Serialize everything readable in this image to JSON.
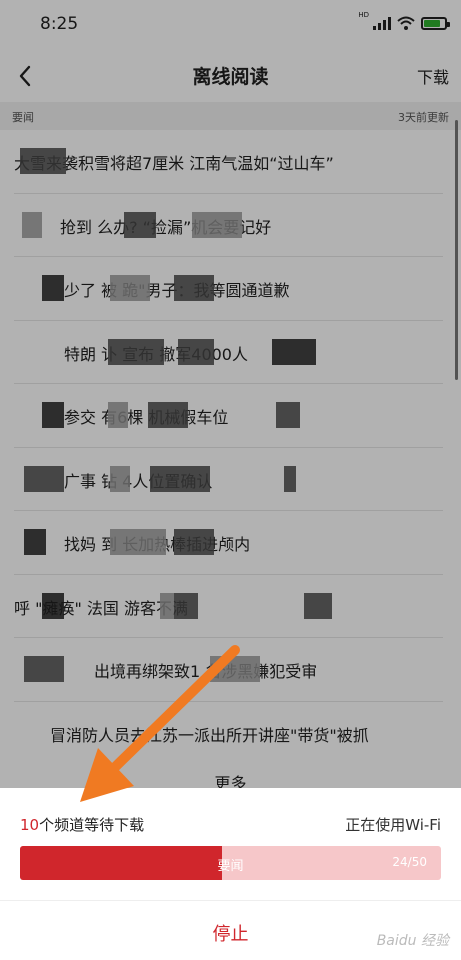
{
  "status_bar": {
    "time": "8:25",
    "network_badge": "HD"
  },
  "nav": {
    "title": "离线阅读",
    "action": "下载"
  },
  "section": {
    "label": "要闻",
    "updated": "3天前更新"
  },
  "news": [
    "大雪来袭积雪将超7厘米 江南气温如“过山车”",
    "抢到        么办?          “捡漏”机会要记好",
    "少了           被        跪\"男子：我等圆通道歉",
    "特朗          讣          宣布         撤军4000人",
    "参交                  有6棵          机械假车位",
    "广事                     钻          4人位置确认",
    "找妈                   到           长加热棒插进颅内",
    "               呼            \"瘫痪\" 法国         游客不满",
    "出境再绑架致1          名涉黑嫌犯受审",
    "冒消防人员去江苏一派出所开讲座\"带货\"被抓"
  ],
  "more": "更多",
  "sheet": {
    "pending_count": "10",
    "pending_text": "个频道等待下载",
    "wifi_status": "正在使用Wi-Fi",
    "current_channel": "要闻",
    "progress_text": "24/50",
    "progress_fraction": 0.48,
    "stop_label": "停止"
  },
  "watermark": "Baidu 经验",
  "colors": {
    "accent": "#d0262c",
    "progress_bg": "#f6c7c9",
    "arrow": "#f07a22"
  }
}
